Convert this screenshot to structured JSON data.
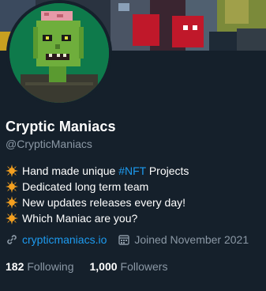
{
  "profile": {
    "display_name": "Cryptic Maniacs",
    "handle": "@CrypticManiacs"
  },
  "bio": {
    "lines": [
      {
        "icon": "sun-emoji-icon",
        "text_before": "Hand made unique ",
        "hashtag": "#NFT",
        "text_after": " Projects"
      },
      {
        "icon": "sun-emoji-icon",
        "text": "Dedicated long term team"
      },
      {
        "icon": "sun-emoji-icon",
        "text": "New updates releases every day!"
      },
      {
        "icon": "sun-emoji-icon",
        "text": "Which Maniac are you?"
      }
    ]
  },
  "meta": {
    "link_icon": "link-icon",
    "website": "crypticmaniacs.io",
    "calendar_icon": "calendar-icon",
    "joined": "Joined November 2021"
  },
  "stats": {
    "following_count": "182",
    "following_label": "Following",
    "followers_count": "1,000",
    "followers_label": "Followers"
  },
  "colors": {
    "background": "#15202b",
    "link": "#1d9bf0",
    "secondary_text": "#8b98a5",
    "avatar_bg": "#0e7a4b",
    "sun": "#f4a020"
  }
}
